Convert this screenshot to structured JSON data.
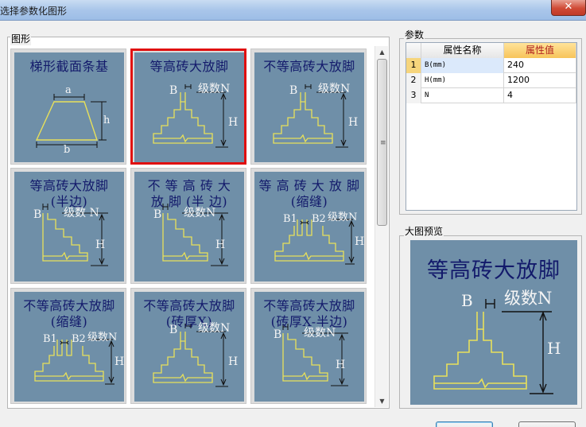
{
  "window": {
    "title": "选择参数化图形",
    "close_glyph": "✕"
  },
  "gallery": {
    "group_label": "图形",
    "selected_index": 1,
    "tiles": [
      {
        "title": "梯形截面条基",
        "type": "trapezoid",
        "labels": {
          "a": "a",
          "b": "b",
          "h": "h"
        }
      },
      {
        "title": "等高砖大放脚",
        "type": "equal",
        "labels": {
          "B": "B",
          "N": "级数N",
          "H": "H"
        }
      },
      {
        "title": "不等高砖大放脚",
        "type": "unequal",
        "labels": {
          "B": "B",
          "N": "级数N",
          "H": "H"
        }
      },
      {
        "title": "等高砖大放脚\n(半边)",
        "type": "half",
        "labels": {
          "B": "B",
          "N": "级数 N",
          "H": "H"
        }
      },
      {
        "title": "不 等 高 砖 大\n放 脚 (半 边)",
        "type": "half",
        "labels": {
          "B": "B",
          "N": "级数N",
          "H": "H"
        }
      },
      {
        "title": "等 高 砖 大 放 脚\n(缩缝)",
        "type": "joint",
        "labels": {
          "B1": "B1",
          "B2": "B2",
          "N": "级数N",
          "H": "H"
        }
      },
      {
        "title": "不等高砖大放脚\n(缩缝)",
        "type": "joint",
        "labels": {
          "B1": "B1",
          "B2": "B2",
          "N": "级数N",
          "H": "H"
        }
      },
      {
        "title": "不等高砖大放脚\n(砖厚X)",
        "type": "equal",
        "labels": {
          "B": "B",
          "N": "级数N",
          "H": "H"
        }
      },
      {
        "title": "不等高砖大放脚\n(砖厚X-半边)",
        "type": "half",
        "labels": {
          "B": "B",
          "N": "级数N",
          "H": "H"
        }
      }
    ],
    "scroll_up": "▲",
    "scroll_down": "▼",
    "scroll_grip": "≡"
  },
  "params": {
    "group_label": "参数",
    "header": {
      "num": "",
      "name": "属性名称",
      "value": "属性值"
    },
    "rows": [
      {
        "num": "1",
        "name": "B(mm)",
        "value": "240"
      },
      {
        "num": "2",
        "name": "H(mm)",
        "value": "1200"
      },
      {
        "num": "3",
        "name": "N",
        "value": "4"
      }
    ]
  },
  "preview": {
    "group_label": "大图预览",
    "title": "等高砖大放脚",
    "labels": {
      "B": "B",
      "N": "级数N",
      "H": "H"
    }
  },
  "buttons": {
    "ok": "",
    "cancel": ""
  },
  "colors": {
    "tile_bg": "#6f8fa8",
    "title_text": "#131a6b",
    "drawing_line": "#e8e05a",
    "selection": "#e01010"
  }
}
